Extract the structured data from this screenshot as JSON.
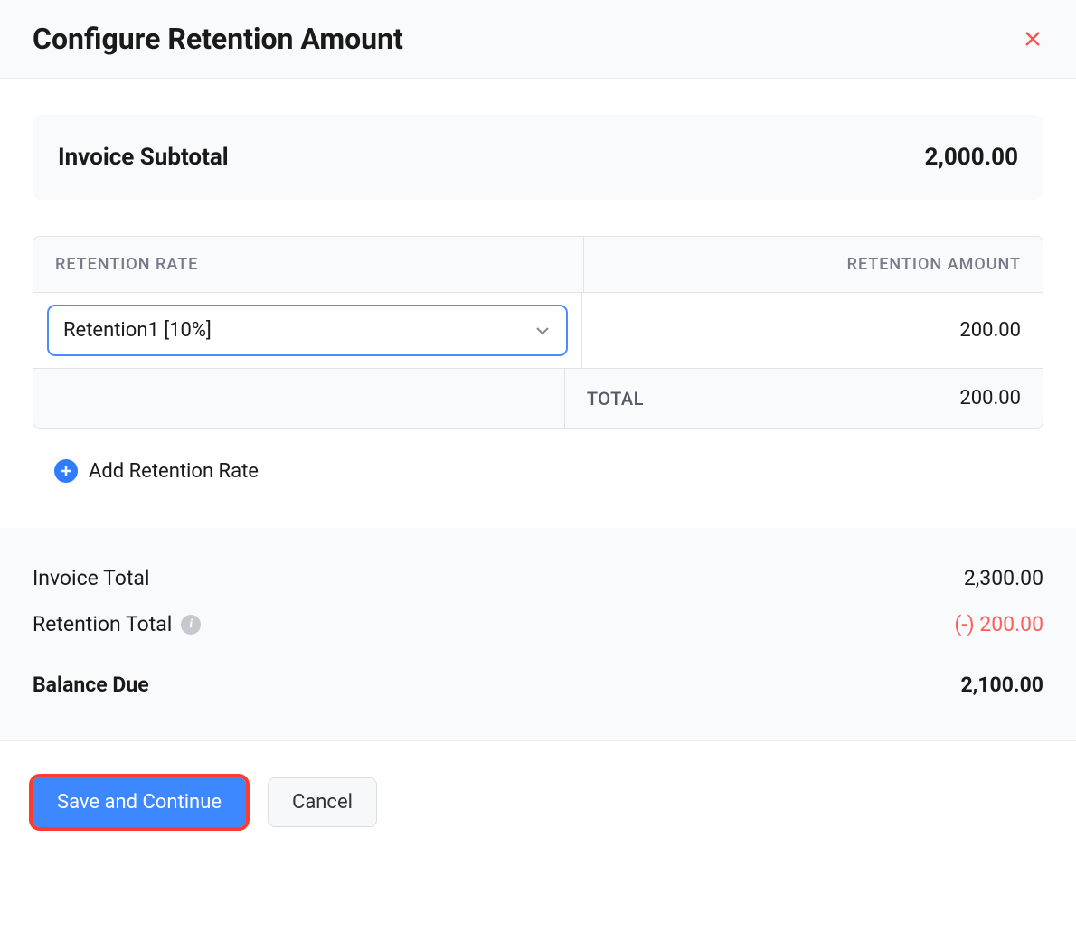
{
  "modal": {
    "title": "Configure Retention Amount"
  },
  "subtotal": {
    "label": "Invoice Subtotal",
    "value": "2,000.00"
  },
  "retentionTable": {
    "headers": {
      "rate": "RETENTION RATE",
      "amount": "RETENTION AMOUNT"
    },
    "rows": [
      {
        "rate": "Retention1 [10%]",
        "amount": "200.00"
      }
    ],
    "totalLabel": "TOTAL",
    "totalValue": "200.00"
  },
  "addRetention": {
    "label": "Add Retention Rate"
  },
  "summary": {
    "invoiceTotal": {
      "label": "Invoice Total",
      "value": "2,300.00"
    },
    "retentionTotal": {
      "label": "Retention Total",
      "value": "(-) 200.00"
    },
    "balanceDue": {
      "label": "Balance Due",
      "value": "2,100.00"
    }
  },
  "footer": {
    "saveLabel": "Save and Continue",
    "cancelLabel": "Cancel"
  }
}
